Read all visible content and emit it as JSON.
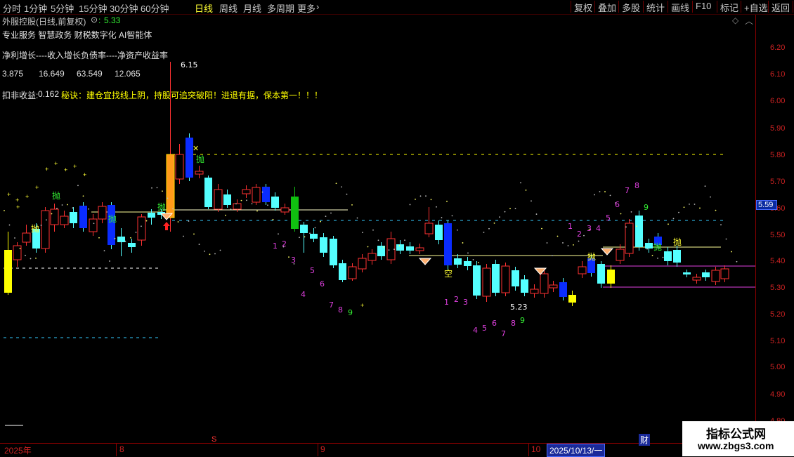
{
  "toolbar": {
    "periods": [
      "分时",
      "1分钟",
      "5分钟",
      "15分钟",
      "30分钟",
      "60分钟",
      "日线",
      "周线",
      "月线",
      "多周期",
      "更多"
    ],
    "active_period": "日线",
    "actions": [
      "复权",
      "叠加",
      "多股",
      "统计",
      "画线",
      "F10",
      "标记",
      "+自选",
      "返回"
    ]
  },
  "header": {
    "stock_title": "外服控股(日线,前复权)",
    "price": "5.33",
    "concepts": "专业服务 智慧政务 财税数字化 AI智能体",
    "metrics_caption": "净利增长----收入增长负债率----净资产收益率",
    "metric_values": [
      "3.875",
      "16.649",
      "63.549",
      "12.065"
    ],
    "deduct_label": "扣非收益:",
    "deduct_value": "0.162",
    "motto": "秘诀：建仓宜找线上阴，持股可追突破阳！进退有据，保本第一！！！"
  },
  "axis": {
    "labels": [
      "6.20",
      "6.10",
      "6.00",
      "5.90",
      "5.80",
      "5.70",
      "5.60",
      "5.50",
      "5.40",
      "5.30",
      "5.20",
      "5.10",
      "5.00",
      "4.90",
      "4.80"
    ],
    "current_price_tag": "5.59"
  },
  "annotations": {
    "high": "6.15",
    "low": "5.23",
    "sell_signal": "抛",
    "empty_signal": "空",
    "x_mark": "✕"
  },
  "datebar": {
    "year": "2025年",
    "months": [
      "8",
      "9",
      "10"
    ],
    "selected_date": "2025/10/13/一",
    "s_mark": "S",
    "finance_mark": "财"
  },
  "watermark": {
    "title": "指标公式网",
    "url": "www.zbgs3.com"
  },
  "colors": {
    "up": "#ff3232",
    "down": "#54ffff",
    "accent_yellow": "#ffff00",
    "magenta": "#e040e0",
    "green_signal": "#00e000"
  }
}
